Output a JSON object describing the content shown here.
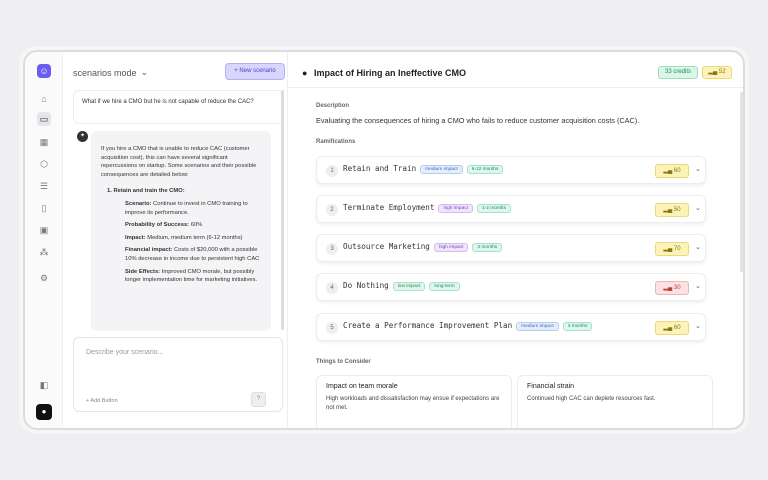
{
  "sidebar": {
    "logo_glyph": "☺",
    "icons": [
      "home-icon",
      "chat-icon",
      "grid-icon",
      "cube-icon",
      "database-icon",
      "book-icon",
      "image-icon",
      "team-icon",
      "settings-icon"
    ],
    "bottom_icons": [
      "collapse-sidebar-icon",
      "user-avatar"
    ]
  },
  "chat": {
    "mode_label": "scenarios mode",
    "mode_chevron": "⌄",
    "new_scenario_label": "+ New scenario",
    "user_message": "What if we hire a CMO but he is not capable of reduce the CAC?",
    "reply": {
      "intro": "If you hire a CMO that is unable to reduce CAC (customer acquisition cost), this can have several significant repercussions on startup. Some scenarios and their possible consequences are detailed below:",
      "item_title": "1.  Retain and train the CMO:",
      "scenario_label": "Scenario:",
      "scenario_text": "Continue to invest in CMO training to improve its performance.",
      "probability_label": "Probability of Success:",
      "probability_text": "60%",
      "impact_label": "Impact:",
      "impact_text": "Medium, medium term (6-12 months)",
      "financial_label": "Financial impact:",
      "financial_text": "Costs of $20,000 with a possible 10% decrease in income due to persistent high CAC",
      "side_label": "Side Effects:",
      "side_text": "Improved CMO morale, but possibly longer implementation time for marketing initiatives."
    },
    "composer_placeholder": "Describe your scenario...",
    "add_button_label": "+ Add Button",
    "send_glyph": "?"
  },
  "main": {
    "title": "Impact of Hiring an Ineffective CMO",
    "credits_label": "33 credits",
    "score_pill": "52",
    "description_label": "Description",
    "description_text": "Evaluating the consequences of hiring a CMO who fails to reduce customer acquisition costs (CAC).",
    "ramifications_label": "Ramifications",
    "ramifications": [
      {
        "num": "1",
        "title": "Retain and Train",
        "impact": "medium impact",
        "impact_class": "t-med",
        "time": "6-12 months",
        "score": "60",
        "score_class": "s-y"
      },
      {
        "num": "2",
        "title": "Terminate Employment",
        "impact": "high impact",
        "impact_class": "t-high",
        "time": "1-2 months",
        "score": "50",
        "score_class": "s-y"
      },
      {
        "num": "3",
        "title": "Outsource Marketing",
        "impact": "high impact",
        "impact_class": "t-high",
        "time": "3 months",
        "score": "70",
        "score_class": "s-y"
      },
      {
        "num": "4",
        "title": "Do Nothing",
        "impact": "low impact",
        "impact_class": "t-low",
        "time": "long-term",
        "score": "30",
        "score_class": "s-r"
      },
      {
        "num": "5",
        "title": "Create a Performance Improvement Plan",
        "impact": "medium impact",
        "impact_class": "t-med",
        "time": "3 months",
        "score": "60",
        "score_class": "s-y"
      }
    ],
    "considerations_label": "Things to Consider",
    "considerations": [
      {
        "title": "Impact on team morale",
        "body": "High workloads and dissatisfaction may ensue if expectations are not met."
      },
      {
        "title": "Financial strain",
        "body": "Continued high CAC can deplete resources fast."
      }
    ]
  }
}
